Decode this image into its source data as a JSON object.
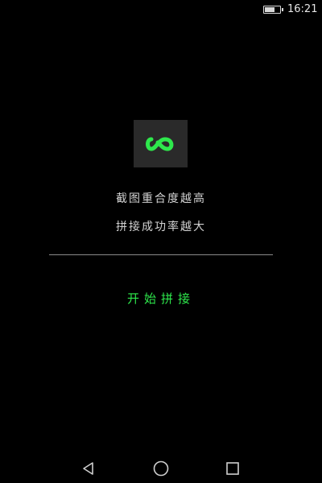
{
  "status_bar": {
    "time": "16:21",
    "battery_icon": "battery-icon",
    "battery_level": 0.7
  },
  "app": {
    "icon": "infinity-logo-icon",
    "accent_color": "#2ee84c",
    "tagline_line1": "截图重合度越高",
    "tagline_line2": "拼接成功率越大",
    "start_button_label": "开始拼接"
  },
  "nav_bar": {
    "back_icon": "back-triangle-icon",
    "home_icon": "home-circle-icon",
    "recent_icon": "recent-square-icon"
  }
}
